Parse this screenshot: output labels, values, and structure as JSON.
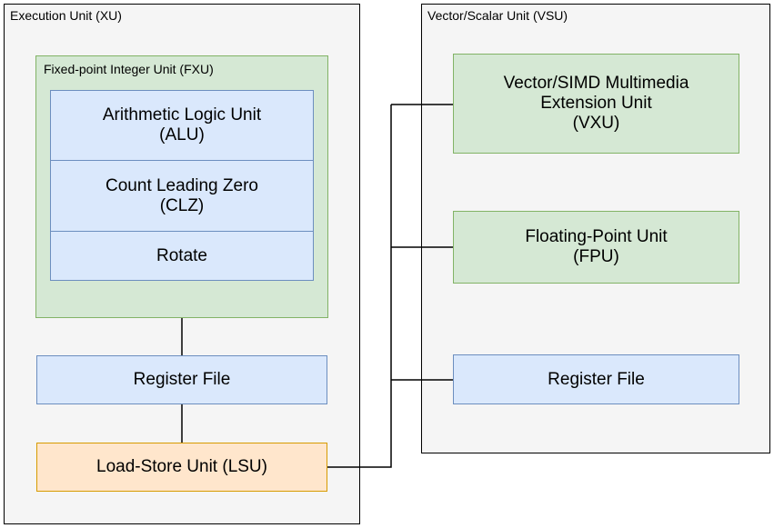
{
  "xu": {
    "title": "Execution Unit (XU)",
    "fxu": {
      "title": "Fixed-point Integer Unit (FXU)",
      "alu": "Arithmetic Logic Unit\n(ALU)",
      "clz": "Count Leading Zero\n(CLZ)",
      "rotate": "Rotate"
    },
    "regfile": "Register File",
    "lsu": "Load-Store Unit (LSU)"
  },
  "vsu": {
    "title": "Vector/Scalar Unit (VSU)",
    "vxu": "Vector/SIMD Multimedia\nExtension Unit\n(VXU)",
    "fpu": "Floating-Point Unit\n(FPU)",
    "regfile": "Register File"
  }
}
